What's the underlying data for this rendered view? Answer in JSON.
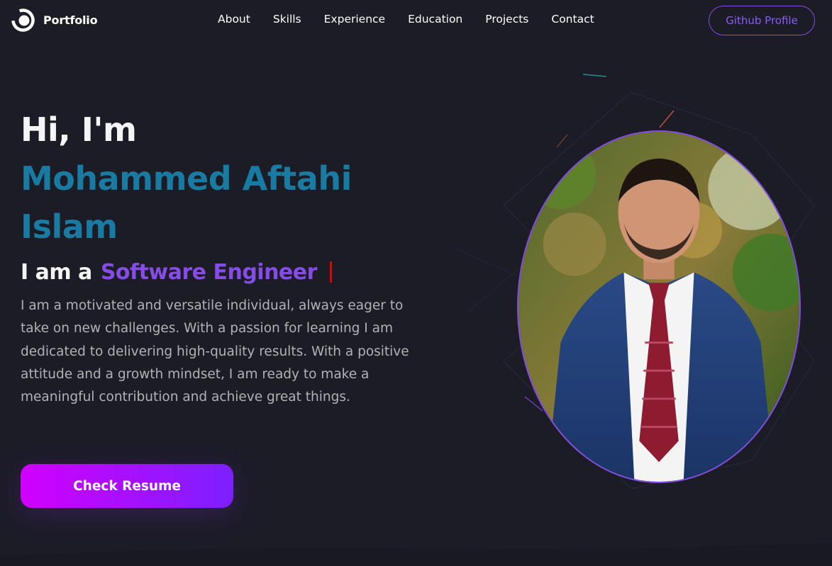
{
  "nav": {
    "logo_text": "Portfolio",
    "links": [
      "About",
      "Skills",
      "Experience",
      "Education",
      "Projects",
      "Contact"
    ],
    "github_button": "Github Profile"
  },
  "hero": {
    "greeting": "Hi, I'm",
    "name": "Mohammed Aftahi Islam",
    "role_prefix": "I am a",
    "role": "Software Engineer",
    "description": "I am a motivated and versatile individual, always eager to take on new challenges. With a passion for learning I am dedicated to delivering high-quality results. With a positive attitude and a growth mindset, I am ready to make a meaningful contribution and achieve great things.",
    "resume_button": "Check Resume"
  },
  "icons": {
    "logo": "logo-circle-icon",
    "photo": "profile-photo"
  },
  "colors": {
    "background": "#1c1c27",
    "primary": "#854ce6",
    "name_color": "#1a7ba2",
    "cursor": "#d40a0a",
    "button_gradient_start": "#d100ff",
    "button_gradient_end": "#7d1fff"
  }
}
